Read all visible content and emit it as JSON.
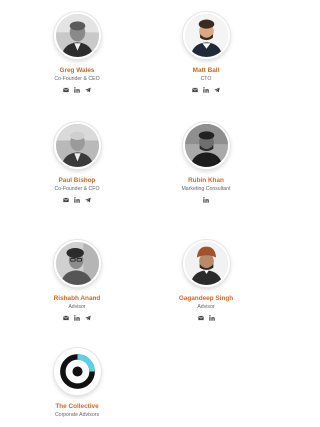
{
  "team": [
    {
      "name": "Greg Wales",
      "role": "Co-Founder & CEO",
      "socials": [
        "email",
        "linkedin",
        "telegram"
      ]
    },
    {
      "name": "Matt Ball",
      "role": "CTO",
      "socials": [
        "email",
        "linkedin",
        "telegram"
      ]
    },
    {
      "name": "Paul Bishop",
      "role": "Co-Founder & CFO",
      "socials": [
        "email",
        "linkedin",
        "telegram"
      ]
    },
    {
      "name": "Rubin Khan",
      "role": "Marketing Consultant",
      "socials": [
        "linkedin"
      ]
    },
    {
      "name": "Rishabh Anand",
      "role": "Advisor",
      "socials": [
        "email",
        "linkedin",
        "telegram"
      ]
    },
    {
      "name": "Gagandeep Singh",
      "role": "Advisor",
      "socials": [
        "email",
        "linkedin"
      ]
    },
    {
      "name": "The Collective",
      "role": "Corporate Advisors",
      "socials": []
    }
  ],
  "colors": {
    "name": "#d9661f",
    "role": "#666666",
    "icon": "#444444",
    "logo_accent": "#5ad3ea"
  }
}
